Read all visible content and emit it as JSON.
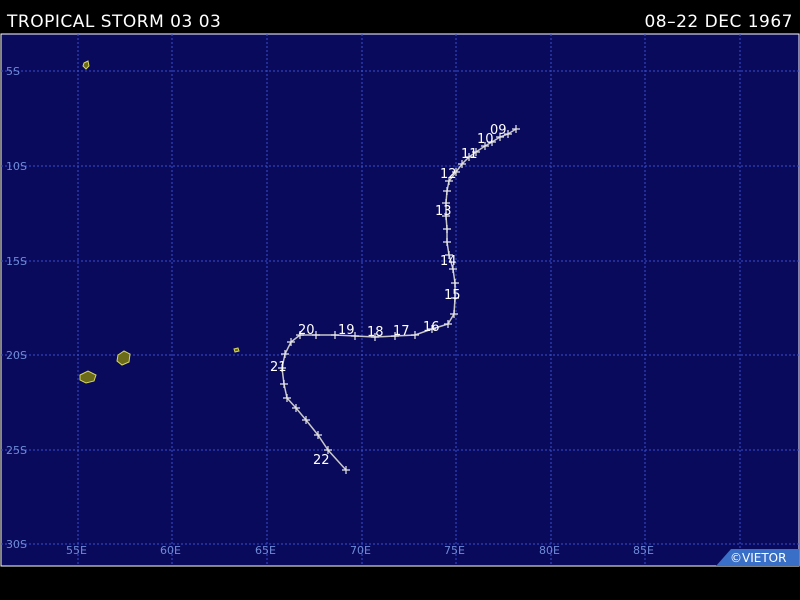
{
  "header": {
    "title": "TROPICAL STORM 03 03",
    "dates": "08–22 DEC 1967"
  },
  "map": {
    "ocean_color": "#0a0a5c",
    "grid_color": "#3a4fd0",
    "land_color": "#6b6b1a",
    "track_color": "#c8c8c8",
    "lat_labels": [
      "5S",
      "10S",
      "15S",
      "20S",
      "25S",
      "30S"
    ],
    "lon_labels": [
      "55E",
      "60E",
      "65E",
      "70E",
      "75E",
      "80E",
      "85E"
    ],
    "day_labels": [
      "09",
      "10",
      "11",
      "12",
      "13",
      "14",
      "15",
      "16",
      "17",
      "18",
      "19",
      "20",
      "21",
      "22"
    ]
  },
  "branding": {
    "text": "©VIETOR"
  }
}
